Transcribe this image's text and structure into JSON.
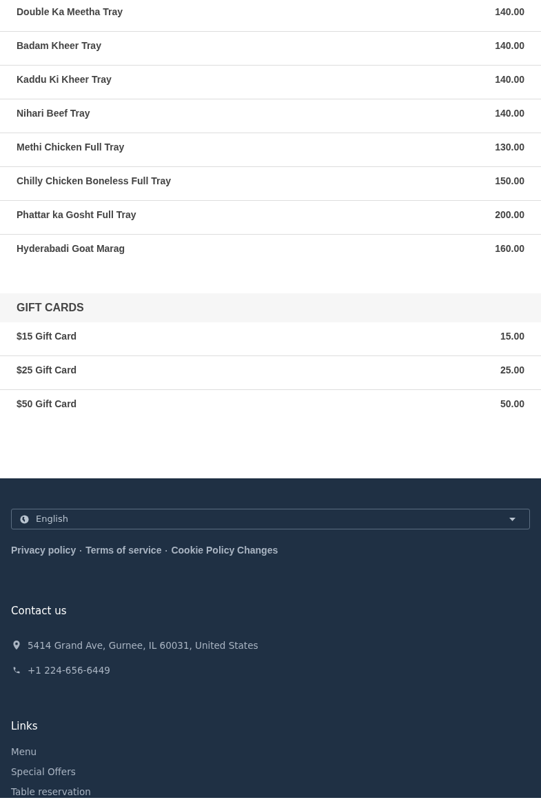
{
  "menu_items": [
    {
      "name": "Double Ka Meetha Tray",
      "price": "140.00"
    },
    {
      "name": "Badam Kheer Tray",
      "price": "140.00"
    },
    {
      "name": "Kaddu Ki Kheer Tray",
      "price": "140.00"
    },
    {
      "name": "Nihari Beef Tray",
      "price": "140.00"
    },
    {
      "name": "Methi Chicken Full Tray",
      "price": "130.00"
    },
    {
      "name": "Chilly Chicken Boneless Full Tray",
      "price": "150.00"
    },
    {
      "name": "Phattar ka Gosht Full Tray",
      "price": "200.00"
    },
    {
      "name": "Hyderabadi Goat Marag",
      "price": "160.00"
    }
  ],
  "gift_cards": {
    "title": "GIFT CARDS",
    "items": [
      {
        "name": "$15 Gift Card",
        "price": "15.00"
      },
      {
        "name": "$25 Gift Card",
        "price": "25.00"
      },
      {
        "name": "$50 Gift Card",
        "price": "50.00"
      }
    ]
  },
  "footer": {
    "language": "English",
    "policy_links": [
      "Privacy policy",
      "Terms of service",
      "Cookie Policy Changes"
    ],
    "separator": "·",
    "contact": {
      "title": "Contact us",
      "address": "5414 Grand Ave, Gurnee, IL 60031, United States",
      "phone": "+1 224-656-6449"
    },
    "links": {
      "title": "Links",
      "items": [
        "Menu",
        "Special Offers",
        "Table reservation"
      ]
    }
  }
}
